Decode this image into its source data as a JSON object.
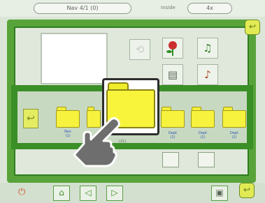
{
  "status_bar": {
    "left_pill": "Nav 4/1 (0)",
    "center_label": "Inside",
    "right_pill": "4x"
  },
  "tools": {
    "row1": [
      "fade-icon",
      "rose-icon",
      "music-notes-icon"
    ],
    "row2": [
      "document-icon",
      "music-note-icon"
    ]
  },
  "folders": {
    "selected_label": "(21)",
    "items": [
      {
        "name": "Nov",
        "count": "(1)"
      },
      {
        "name": "",
        "count": ""
      },
      {
        "name": "Dept",
        "count": "(1)"
      },
      {
        "name": "Dept",
        "count": "(1)"
      },
      {
        "name": "Dept",
        "count": "(1)"
      }
    ]
  },
  "bottom_bar": {
    "buttons": [
      "power-button",
      "home-button",
      "prev-button",
      "next-button",
      "display-button",
      "corner-button"
    ]
  },
  "colors": {
    "frame_green": "#58a43a",
    "strip_green": "#3a8f27",
    "folder_yellow": "#f6f23e",
    "label_blue": "#2e55b8"
  }
}
